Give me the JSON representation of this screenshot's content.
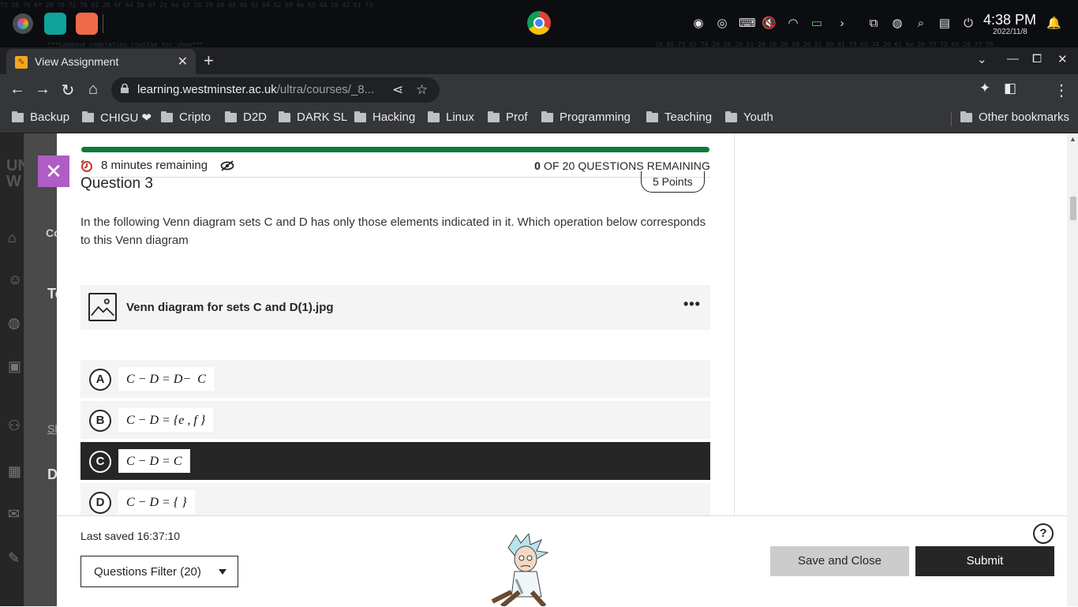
{
  "shelf": {
    "clock": "4:38 PM",
    "date": "2022/11/8",
    "terminal_noise": [
      "73 20 76 6f 20 70 71 70 61 20 6f 64 56 6f 2c 6a 67 28 29 b9 d3 46 62 64 62 69 4e 65 44 20 42 61 73",
      "***Command completion routine for show***",
      "70 65 73 65 74 20 58 20 51 20 50 20 59 20 51 00 01 73 65 74 20 61 6e 2e 73 75 6d 20 73 70"
    ],
    "colors": {
      "background": "#0b0d10"
    }
  },
  "browser": {
    "tab_title": "View Assignment",
    "tab_close": "✕",
    "new_tab": "+",
    "url_host": "learning.westminster.ac.uk",
    "url_path": "/ultra/courses/_8...",
    "bookmarks": [
      "Backup",
      "CHIGU ❤",
      "Cripto",
      "D2D",
      "DARK SL",
      "Hacking",
      "Linux",
      "Prof",
      "Programming",
      "Teaching",
      "Youth"
    ],
    "other_bookmarks": "Other bookmarks"
  },
  "background_page": {
    "left_letters": [
      "UN",
      "W"
    ],
    "items": [
      "Co",
      "Te",
      "Sh",
      "D"
    ]
  },
  "assignment": {
    "close_label": "✕",
    "progress_fraction": 1.0,
    "time_remaining": "8 minutes remaining",
    "questions_remaining_count": "0",
    "questions_remaining_text": "OF 20 QUESTIONS REMAINING",
    "question_title": "Question 3",
    "points": "5 Points",
    "question_text": "In the following Venn diagram sets C and D has only those elements indicated in it. Which operation below corresponds to this Venn diagram",
    "attachment_name": "Venn diagram for sets C and D(1).jpg",
    "attachment_more": "•••",
    "options": [
      {
        "letter": "A",
        "expression": "C − D = D−  C",
        "selected": false
      },
      {
        "letter": "B",
        "expression": "C − D = {e , f }",
        "selected": false
      },
      {
        "letter": "C",
        "expression": "C − D = C",
        "selected": true
      },
      {
        "letter": "D",
        "expression": "C − D = { }",
        "selected": false
      }
    ],
    "colors": {
      "accent_purple": "#b05cc7",
      "progress_green": "#0d7a38",
      "dark": "#262626"
    }
  },
  "footer": {
    "last_saved": "Last saved 16:37:10",
    "filter_label": "Questions Filter (20)",
    "save_close": "Save and Close",
    "submit": "Submit",
    "help": "?"
  }
}
